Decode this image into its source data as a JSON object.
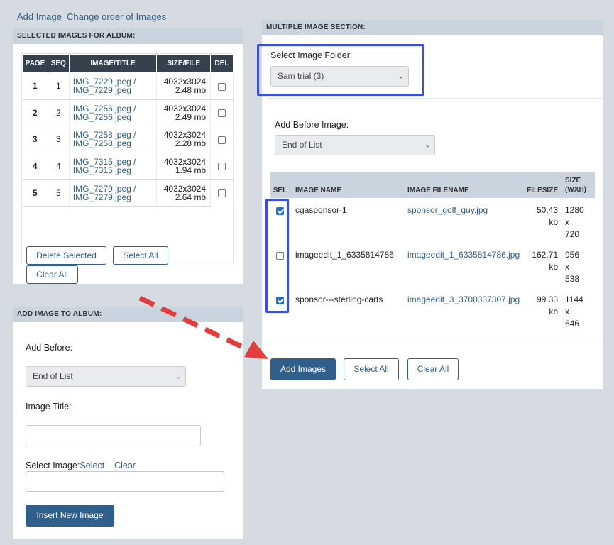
{
  "top_links": {
    "add_image": "Add Image",
    "change_order": "Change order of Images"
  },
  "selected": {
    "header": "SELECTED IMAGES FOR ALBUM:",
    "columns": {
      "page": "PAGE",
      "seq": "SEQ",
      "image": "IMAGE/TITLE",
      "size": "SIZE/FILE",
      "del": "DEL"
    },
    "rows": [
      {
        "page": "1",
        "seq": "1",
        "line1": "IMG_7229.jpeg /",
        "line2": "IMG_7229.jpeg",
        "dims": "4032x3024",
        "file": "2.48 mb"
      },
      {
        "page": "2",
        "seq": "2",
        "line1": "IMG_7256.jpeg /",
        "line2": "IMG_7256.jpeg",
        "dims": "4032x3024",
        "file": "2.49 mb"
      },
      {
        "page": "3",
        "seq": "3",
        "line1": "IMG_7258.jpeg /",
        "line2": "IMG_7258.jpeg",
        "dims": "4032x3024",
        "file": "2.28 mb"
      },
      {
        "page": "4",
        "seq": "4",
        "line1": "IMG_7315.jpeg /",
        "line2": "IMG_7315.jpeg",
        "dims": "4032x3024",
        "file": "1.94 mb"
      },
      {
        "page": "5",
        "seq": "5",
        "line1": "IMG_7279.jpeg /",
        "line2": "IMG_7279.jpeg",
        "dims": "4032x3024",
        "file": "2.64 mb"
      }
    ],
    "delete_selected": "Delete Selected",
    "select_all": "Select All",
    "clear_all": "Clear All"
  },
  "add_image": {
    "header": "ADD IMAGE TO ALBUM:",
    "add_before_label": "Add Before:",
    "add_before_value": "End of List",
    "title_label": "Image Title:",
    "title_value": "",
    "select_label": "Select Image:",
    "select_link": "Select",
    "clear_link": "Clear",
    "select_value": "",
    "insert_button": "Insert New Image"
  },
  "multiple": {
    "header": "MULTIPLE IMAGE SECTION:",
    "folder_label": "Select Image Folder:",
    "folder_value": "Sam trial (3)",
    "before_label": "Add Before Image:",
    "before_value": "End of List",
    "columns": {
      "sel": "SEL",
      "name": "IMAGE NAME",
      "filename": "IMAGE FILENAME",
      "filesize": "FILESIZE",
      "size_l1": "SIZE",
      "size_l2": "(WXH)"
    },
    "rows": [
      {
        "checked": true,
        "name": "cgasponsor-1",
        "filename": "sponsor_golf_guy.jpg",
        "fs1": "50.43",
        "fs2": "kb",
        "w": "1280",
        "x": "x",
        "h": "720"
      },
      {
        "checked": false,
        "name": "imageedit_1_6335814786",
        "filename": "imageedit_1_6335814786.jpg",
        "fs1": "162.71",
        "fs2": "kb",
        "w": "956",
        "x": "x",
        "h": "538"
      },
      {
        "checked": true,
        "name": "sponsor---sterling-carts",
        "filename": "imageedit_3_3700337307.jpg",
        "fs1": "99.33",
        "fs2": "kb",
        "w": "1144",
        "x": "x",
        "h": "646"
      }
    ],
    "add_images": "Add Images",
    "select_all": "Select All",
    "clear_all": "Clear All"
  },
  "colors": {
    "highlight": "#3b4fe0",
    "arrow": "#e63b3b",
    "accent": "#2f5f8a"
  }
}
